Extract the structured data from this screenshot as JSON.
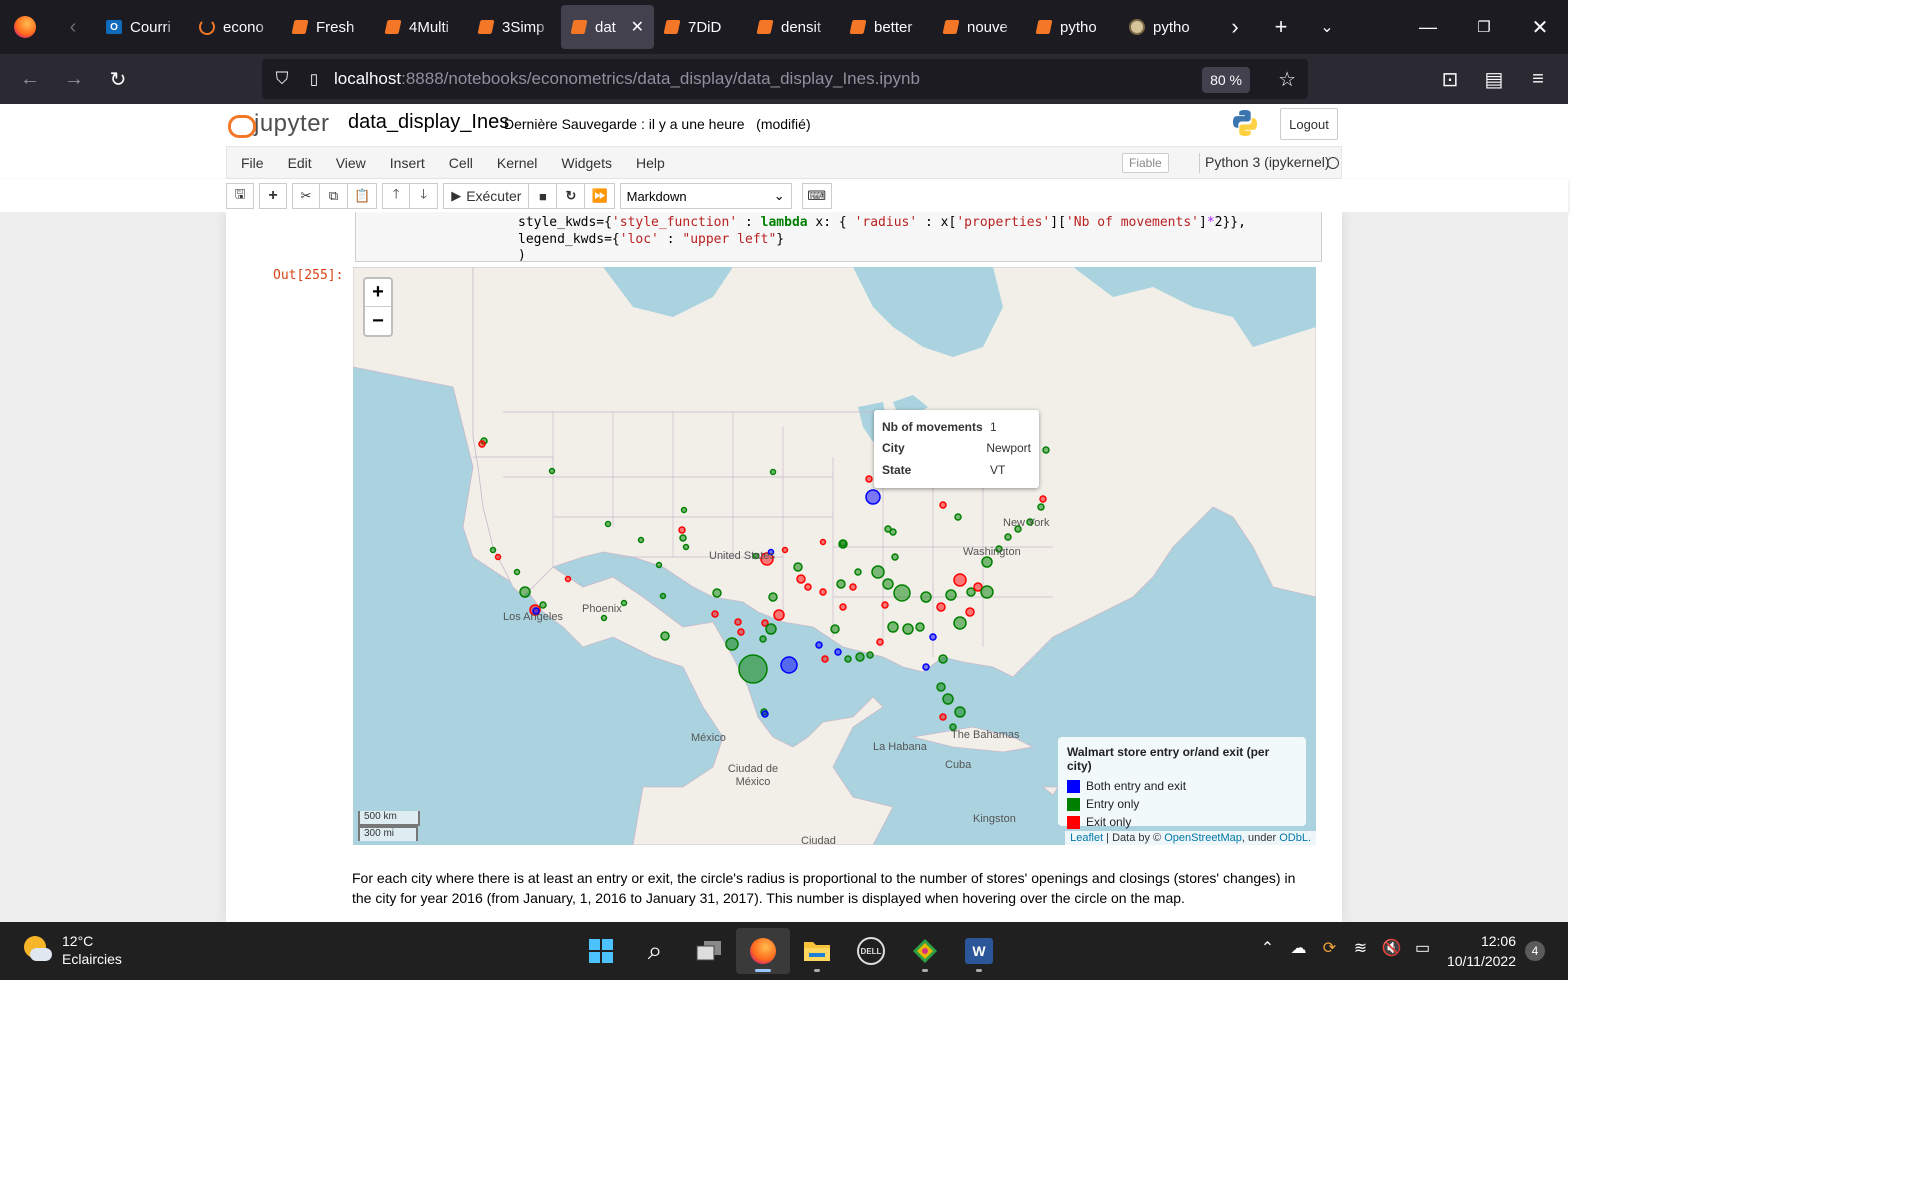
{
  "browser": {
    "tabs": [
      {
        "label": "Courri",
        "icon": "outlook-icon"
      },
      {
        "label": "econo",
        "icon": "jupyter-ring-icon"
      },
      {
        "label": "Fresh",
        "icon": "notebook-icon"
      },
      {
        "label": "4Multi",
        "icon": "notebook-icon"
      },
      {
        "label": "3Simp",
        "icon": "notebook-icon"
      },
      {
        "label": "dat",
        "icon": "notebook-icon",
        "active": true
      },
      {
        "label": "7DiD",
        "icon": "notebook-icon"
      },
      {
        "label": "densit",
        "icon": "notebook-icon"
      },
      {
        "label": "better",
        "icon": "notebook-icon"
      },
      {
        "label": "nouve",
        "icon": "notebook-icon"
      },
      {
        "label": "pytho",
        "icon": "python-doc-icon"
      },
      {
        "label": "pytho",
        "icon": "python-logo-icon"
      }
    ],
    "url_host": "localhost",
    "url_path": ":8888/notebooks/econometrics/data_display/data_display_Ines.ipynb",
    "zoom": "80 %"
  },
  "jupyter": {
    "logo_text": "jupyter",
    "notebook_name": "data_display_Ines",
    "save_status": "Dernière Sauvegarde : il y a une heure   (modifié)",
    "logout": "Logout",
    "menu": [
      "File",
      "Edit",
      "View",
      "Insert",
      "Cell",
      "Kernel",
      "Widgets",
      "Help"
    ],
    "trusted": "Fiable",
    "kernel": "Python 3 (ipykernel)",
    "run_label": "Exécuter",
    "cell_type": "Markdown"
  },
  "cell": {
    "out_prompt": "Out[255]:",
    "description": "For each city where there is at least an entry or exit, the circle's radius is proportional to the number of stores' openings and closings (stores' changes) in the city for year 2016 (from January, 1, 2016 to January 31, 2017). This number is displayed when hovering over the circle on the map."
  },
  "map": {
    "popup": {
      "rows": [
        {
          "key": "Nb of movements",
          "value": "1"
        },
        {
          "key": "City",
          "value": "Newport"
        },
        {
          "key": "State",
          "value": "VT"
        }
      ]
    },
    "legend": {
      "title": "Walmart store entry or/and exit (per city)",
      "items": [
        {
          "label": "Both entry and exit",
          "color": "#0000ff"
        },
        {
          "label": "Entry only",
          "color": "#008000"
        },
        {
          "label": "Exit only",
          "color": "#ff0000"
        }
      ]
    },
    "scale": {
      "km": "500 km",
      "mi": "300 mi"
    },
    "attribution": {
      "leaflet": "Leaflet",
      "mid": " | Data by © ",
      "osm": "OpenStreetMap",
      "under": ", under ",
      "odbl": "ODbL."
    },
    "labels": {
      "united_states": "United States",
      "new_york": "New York",
      "washington": "Washington",
      "phoenix": "Phoenix",
      "los_angeles": "Los Angeles",
      "mexico": "México",
      "ciudad_de_mexico": "Ciudad de México",
      "la_habana": "La Habana",
      "cuba": "Cuba",
      "bahamas": "The Bahamas",
      "kingston": "Kingston",
      "ciudad": "Ciudad"
    },
    "colors": {
      "water": "#aad3df",
      "land": "#f2efe9",
      "entry": "#008000",
      "exit": "#ff0000",
      "both": "#0000ff"
    }
  },
  "taskbar": {
    "temperature": "12°C",
    "condition": "Eclaircies",
    "time": "12:06",
    "date": "10/11/2022",
    "notifications": "4"
  }
}
